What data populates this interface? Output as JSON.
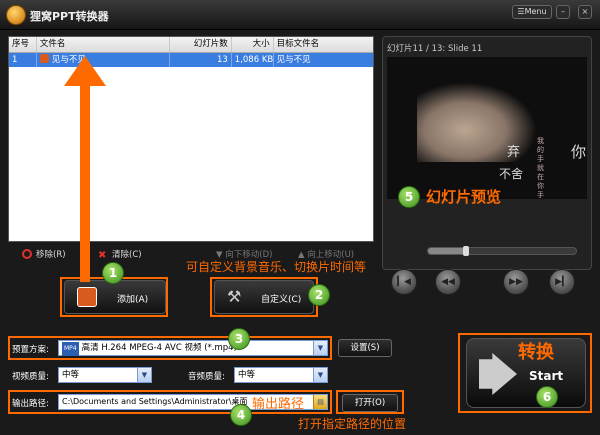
{
  "window": {
    "title": "狸窝PPT转换器",
    "menu_label": "Menu",
    "minimize": "–",
    "close": "×"
  },
  "file_list": {
    "columns": [
      "序号",
      "文件名",
      "幻灯片数",
      "大小",
      "目标文件名"
    ],
    "rows": [
      {
        "index": "1",
        "filename": "见与不见",
        "slides": "13",
        "size": "1,086 KB",
        "target": "见与不见"
      }
    ]
  },
  "list_toolbar": {
    "remove_label": "移除(R)",
    "clear_label": "清除(C)",
    "move_down_label": "向下移动(D)",
    "move_up_label": "向上移动(U)"
  },
  "preview": {
    "header": "幻灯片11 / 13: Slide 11",
    "slide_text": [
      "你",
      "弃",
      "不舍",
      "我的手就在你手里"
    ],
    "slider_percent": 26
  },
  "buttons": {
    "add_label": "添加(A)",
    "custom_label": "自定义(C)"
  },
  "settings": {
    "preset_label": "预置方案:",
    "preset_value": "高清 H.264 MPEG-4 AVC 视频 (*.mp4)",
    "settings_button": "设置(S)",
    "video_quality_label": "视频质量:",
    "video_quality_value": "中等",
    "audio_quality_label": "音频质量:",
    "audio_quality_value": "中等",
    "output_path_label": "输出路径:",
    "output_path_value": "C:\\Documents and Settings\\Administrator\\桌面",
    "open_button": "打开(O)",
    "start_label": "Start"
  },
  "annotations": {
    "n1": "1",
    "n2": "2",
    "n3": "3",
    "n4": "4",
    "n5": "5",
    "n6": "6",
    "custom_hint": "可自定义背景音乐、切换片时间等",
    "preview_hint": "幻灯片预览",
    "output_hint": "输出路径",
    "open_hint": "打开指定路径的位置",
    "convert_hint": "转换"
  },
  "colors": {
    "accent_orange": "#ff6a00",
    "selection_blue": "#3a7de0"
  }
}
